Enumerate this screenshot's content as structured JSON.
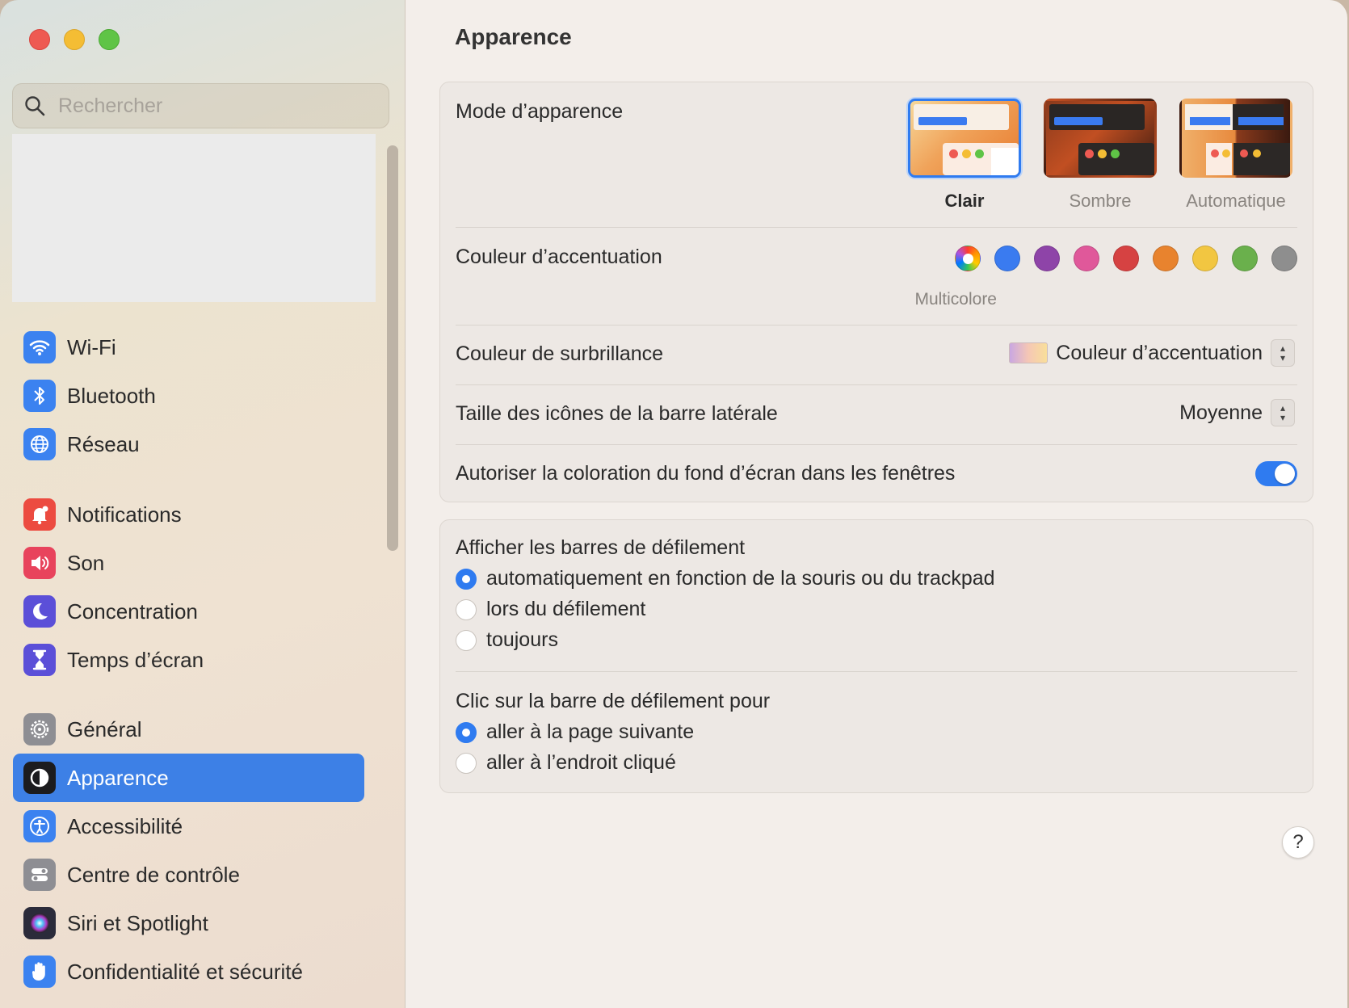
{
  "search": {
    "placeholder": "Rechercher"
  },
  "sidebar": {
    "groups": [
      [
        {
          "label": "Wi-Fi",
          "icon": "wifi-icon",
          "color": "#3b82f0"
        },
        {
          "label": "Bluetooth",
          "icon": "bluetooth-icon",
          "color": "#3b82f0"
        },
        {
          "label": "Réseau",
          "icon": "globe-icon",
          "color": "#3b82f0"
        }
      ],
      [
        {
          "label": "Notifications",
          "icon": "bell-icon",
          "color": "#ec4b40"
        },
        {
          "label": "Son",
          "icon": "speaker-icon",
          "color": "#e8435c"
        },
        {
          "label": "Concentration",
          "icon": "moon-icon",
          "color": "#5b4fd8"
        },
        {
          "label": "Temps d’écran",
          "icon": "hourglass-icon",
          "color": "#5b4fd8"
        }
      ],
      [
        {
          "label": "Général",
          "icon": "gear-icon",
          "color": "#8e8e93"
        },
        {
          "label": "Apparence",
          "icon": "appearance-icon",
          "color": "#1c1c1e",
          "selected": true
        },
        {
          "label": "Accessibilité",
          "icon": "accessibility-icon",
          "color": "#3b82f0"
        },
        {
          "label": "Centre de contrôle",
          "icon": "control-center-icon",
          "color": "#8e8e93"
        },
        {
          "label": "Siri et Spotlight",
          "icon": "siri-icon",
          "color": "#2b2b3a"
        },
        {
          "label": "Confidentialité et sécurité",
          "icon": "hand-icon",
          "color": "#3b82f0"
        }
      ]
    ]
  },
  "main": {
    "title": "Apparence",
    "appearance_mode": {
      "label": "Mode d’apparence",
      "options": [
        {
          "label": "Clair",
          "selected": true
        },
        {
          "label": "Sombre",
          "selected": false
        },
        {
          "label": "Automatique",
          "selected": false
        }
      ]
    },
    "accent": {
      "label": "Couleur d’accentuation",
      "caption": "Multicolore",
      "colors": [
        "multicolor",
        "#3a7bf0",
        "#8e44a8",
        "#e0589a",
        "#d64242",
        "#e8832e",
        "#f2c641",
        "#6ab04c",
        "#8e8e8e"
      ]
    },
    "highlight": {
      "label": "Couleur de surbrillance",
      "value": "Couleur d’accentuation"
    },
    "sidebar_icon_size": {
      "label": "Taille des icônes de la barre latérale",
      "value": "Moyenne"
    },
    "wallpaper_tinting": {
      "label": "Autoriser la coloration du fond d’écran dans les fenêtres",
      "on": true
    },
    "show_scrollbars": {
      "label": "Afficher les barres de défilement",
      "options": [
        {
          "label": "automatiquement en fonction de la souris ou du trackpad",
          "selected": true
        },
        {
          "label": "lors du défilement",
          "selected": false
        },
        {
          "label": "toujours",
          "selected": false
        }
      ]
    },
    "click_scrollbar": {
      "label": "Clic sur la barre de défilement pour",
      "options": [
        {
          "label": "aller à la page suivante",
          "selected": true
        },
        {
          "label": "aller à l’endroit cliqué",
          "selected": false
        }
      ]
    },
    "help_label": "?"
  }
}
